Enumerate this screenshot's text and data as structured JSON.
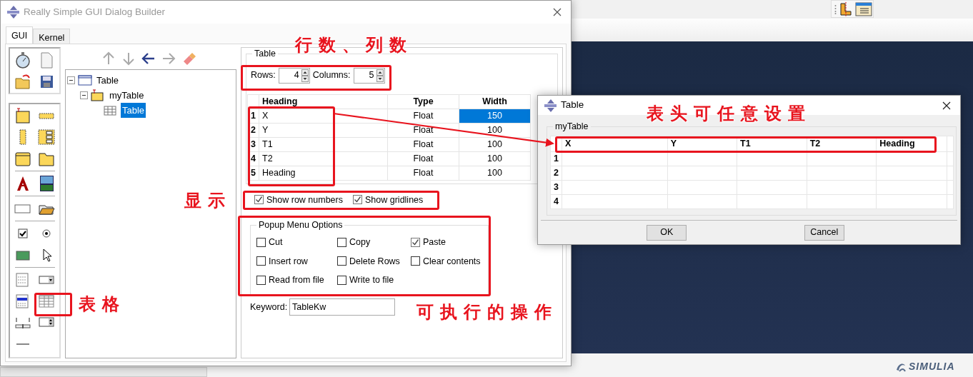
{
  "builder_window": {
    "title": "Really Simple GUI Dialog Builder",
    "tabs": [
      {
        "label": "GUI",
        "selected": true
      },
      {
        "label": "Kernel",
        "selected": false
      }
    ],
    "tree": [
      {
        "label": "Table",
        "kind": "dialog",
        "selected": false,
        "expanded": true,
        "children": [
          {
            "label": "myTable",
            "kind": "frame",
            "selected": false,
            "expanded": true,
            "children": [
              {
                "label": "Table",
                "kind": "table",
                "selected": true
              }
            ]
          }
        ]
      }
    ],
    "properties": {
      "group_title": "Table",
      "rows_label": "Rows:",
      "rows_value": "4",
      "columns_label": "Columns:",
      "columns_value": "5",
      "table": {
        "columns": [
          "Heading",
          "Type",
          "Width"
        ],
        "rows": [
          {
            "number": "1",
            "cells": [
              {
                "text": "X",
                "selected": false
              },
              {
                "text": "Float",
                "selected": false
              },
              {
                "text": "150",
                "selected": true
              }
            ]
          },
          {
            "number": "2",
            "cells": [
              {
                "text": "Y",
                "selected": false
              },
              {
                "text": "Float",
                "selected": false
              },
              {
                "text": "100",
                "selected": false
              }
            ]
          },
          {
            "number": "3",
            "cells": [
              {
                "text": "T1",
                "selected": false
              },
              {
                "text": "Float",
                "selected": false
              },
              {
                "text": "100",
                "selected": false
              }
            ]
          },
          {
            "number": "4",
            "cells": [
              {
                "text": "T2",
                "selected": false
              },
              {
                "text": "Float",
                "selected": false
              },
              {
                "text": "100",
                "selected": false
              }
            ]
          },
          {
            "number": "5",
            "cells": [
              {
                "text": "Heading",
                "selected": false
              },
              {
                "text": "Float",
                "selected": false
              },
              {
                "text": "100",
                "selected": false
              }
            ]
          }
        ]
      },
      "display_options": [
        {
          "label": "Show row numbers",
          "checked": true
        },
        {
          "label": "Show gridlines",
          "checked": true
        }
      ],
      "popup_menu": {
        "title": "Popup Menu Options",
        "items": [
          {
            "label": "Cut",
            "checked": false
          },
          {
            "label": "Copy",
            "checked": false
          },
          {
            "label": "Paste",
            "checked": true
          },
          {
            "label": "Insert row",
            "checked": false
          },
          {
            "label": "Delete Rows",
            "checked": false
          },
          {
            "label": "Clear contents",
            "checked": false
          },
          {
            "label": "Read from file",
            "checked": false
          },
          {
            "label": "Write to file",
            "checked": false
          }
        ]
      },
      "keyword": {
        "label": "Keyword:",
        "value": "TableKw"
      }
    }
  },
  "table_dialog": {
    "title": "Table",
    "group_title": "myTable",
    "columns": [
      "X",
      "Y",
      "T1",
      "T2",
      "Heading"
    ],
    "row_numbers": [
      "1",
      "2",
      "3",
      "4"
    ],
    "buttons": [
      "OK",
      "Cancel"
    ]
  },
  "annotations": [
    {
      "text": "行数、列数"
    },
    {
      "text": "表头可任意设置"
    },
    {
      "text": "显示"
    },
    {
      "text": "表格"
    },
    {
      "text": "可执行的操作"
    }
  ],
  "branding": {
    "text": "SIMULIA"
  }
}
